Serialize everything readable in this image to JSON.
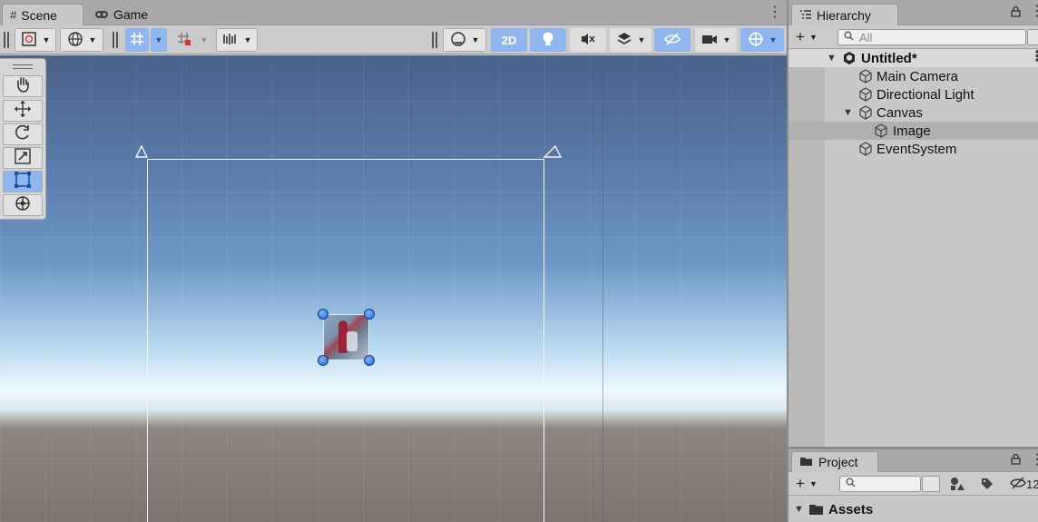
{
  "scene_panel": {
    "tabs": [
      {
        "label": "Scene",
        "icon": "hash-icon"
      },
      {
        "label": "Game",
        "icon": "gamepad-icon"
      }
    ],
    "toolbar": {
      "two_d_label": "2D"
    }
  },
  "hierarchy": {
    "tab_label": "Hierarchy",
    "search_placeholder": "All",
    "scene_name": "Untitled*",
    "items": [
      {
        "label": "Main Camera",
        "depth": 1
      },
      {
        "label": "Directional Light",
        "depth": 1
      },
      {
        "label": "Canvas",
        "depth": 1,
        "expanded": true
      },
      {
        "label": "Image",
        "depth": 2,
        "selected": true
      },
      {
        "label": "EventSystem",
        "depth": 1
      }
    ]
  },
  "project": {
    "tab_label": "Project",
    "hidden_count": "12",
    "folders": [
      {
        "label": "Assets",
        "expanded": true
      }
    ]
  },
  "colors": {
    "selection_blue": "#8fb6ef",
    "handle_blue": "#1f64d6"
  }
}
